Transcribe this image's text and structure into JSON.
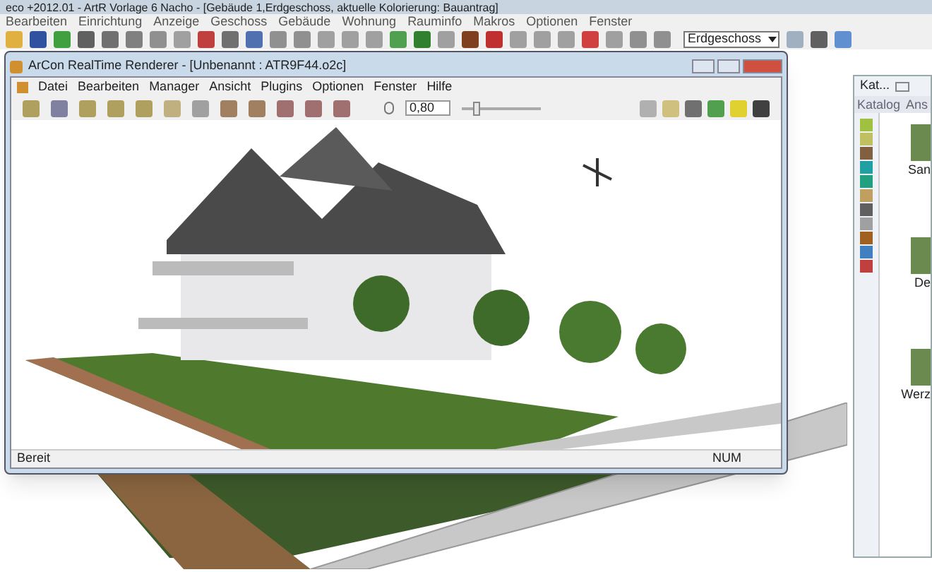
{
  "app": {
    "title": "eco  +2012.01 - ArtR Vorlage 6 Nacho - [Gebäude 1,Erdgeschoss, aktuelle Kolorierung: Bauantrag]",
    "menu": [
      "Bearbeiten",
      "Einrichtung",
      "Anzeige",
      "Geschoss",
      "Gebäude",
      "Wohnung",
      "Rauminfo",
      "Makros",
      "Optionen",
      "Fenster"
    ],
    "floor_select": "Erdgeschoss"
  },
  "catalog": {
    "title": "Kat...",
    "menu": [
      "Katalog",
      "Ans"
    ],
    "items": [
      {
        "label": "San"
      },
      {
        "label": "De"
      },
      {
        "label": "Werz"
      }
    ]
  },
  "renderer": {
    "title": "ArCon RealTime Renderer - [Unbenannt : ATR9F44.o2c]",
    "menu": [
      "Datei",
      "Bearbeiten",
      "Manager",
      "Ansicht",
      "Plugins",
      "Optionen",
      "Fenster",
      "Hilfe"
    ],
    "zoom_value": "0,80",
    "zoom_slider": {
      "level": 0.15
    },
    "status": {
      "text": "Bereit",
      "indicator": "NUM"
    }
  }
}
